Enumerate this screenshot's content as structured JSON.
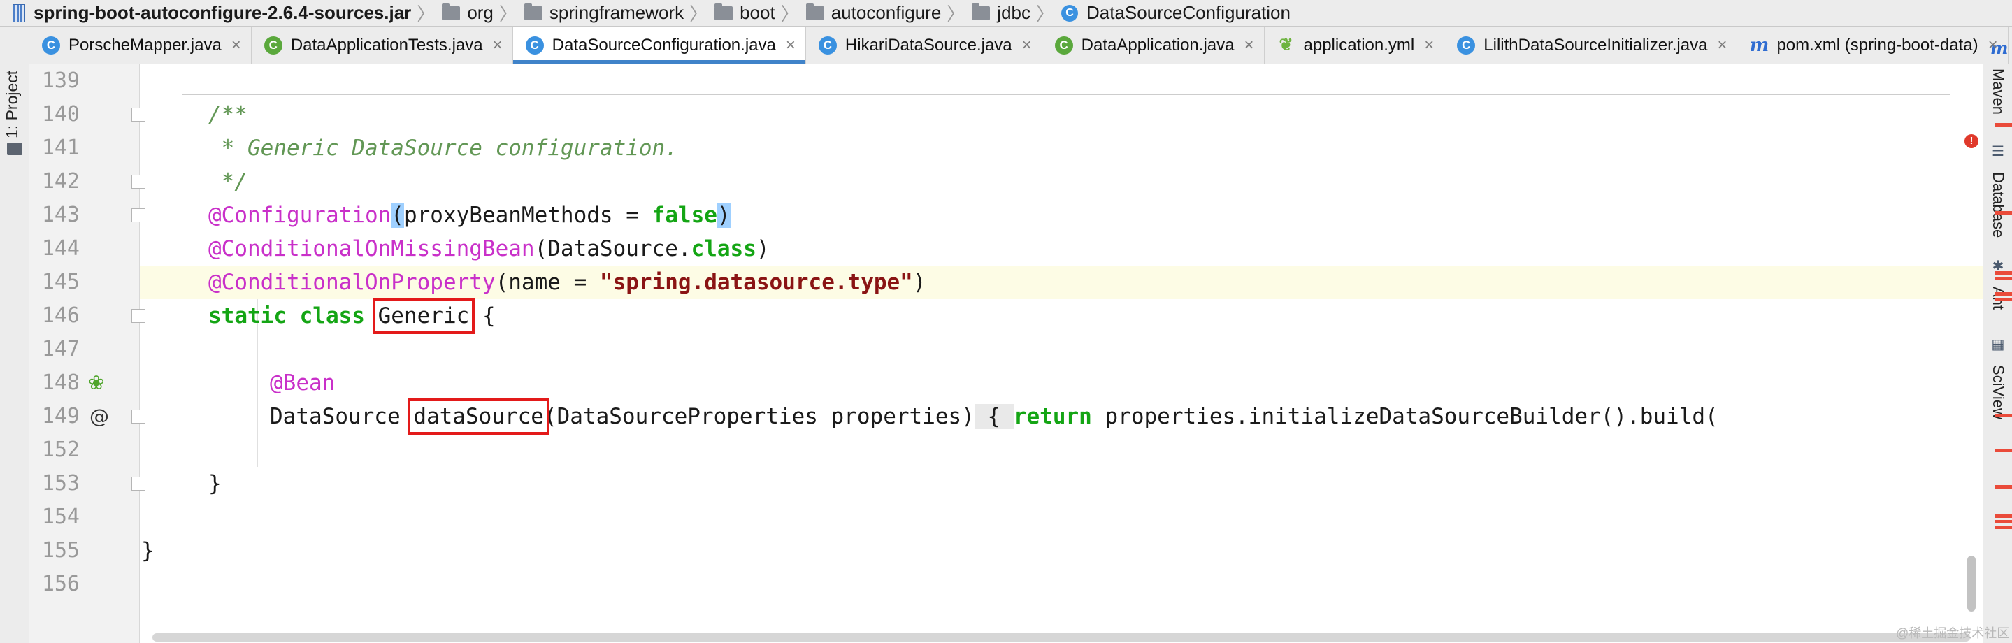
{
  "breadcrumb": [
    {
      "label": "spring-boot-autoconfigure-2.6.4-sources.jar",
      "icon": "jar-icon"
    },
    {
      "label": "org",
      "icon": "folder-icon"
    },
    {
      "label": "springframework",
      "icon": "folder-icon"
    },
    {
      "label": "boot",
      "icon": "folder-icon"
    },
    {
      "label": "autoconfigure",
      "icon": "folder-icon"
    },
    {
      "label": "jdbc",
      "icon": "folder-icon"
    },
    {
      "label": "DataSourceConfiguration",
      "icon": "class-icon"
    }
  ],
  "left_tools": {
    "project": "1: Project"
  },
  "right_tools": {
    "maven": "Maven",
    "database": "Database",
    "ant": "Ant",
    "sciview": "SciView",
    "maven_icon": "m"
  },
  "tabs": [
    {
      "label": "PorscheMapper.java",
      "icon": "C"
    },
    {
      "label": "DataApplicationTests.java",
      "icon": "C"
    },
    {
      "label": "DataSourceConfiguration.java",
      "icon": "C",
      "active": true
    },
    {
      "label": "HikariDataSource.java",
      "icon": "C"
    },
    {
      "label": "DataApplication.java",
      "icon": "C"
    },
    {
      "label": "application.yml",
      "icon": "yml"
    },
    {
      "label": "LilithDataSourceInitializer.java",
      "icon": "C"
    },
    {
      "label": "pom.xml (spring-boot-data)",
      "icon": "m"
    }
  ],
  "editor": {
    "line_numbers": [
      "139",
      "140",
      "141",
      "142",
      "143",
      "144",
      "145",
      "146",
      "147",
      "148",
      "149",
      "152",
      "153",
      "154",
      "155",
      "156"
    ],
    "code": {
      "l140": "/**",
      "l141": " * Generic DataSource configuration.",
      "l142": " */",
      "l143": {
        "anno": "@Configuration",
        "p1": "(",
        "mid": "proxyBeanMethods = ",
        "kw": "false",
        "p2": ")"
      },
      "l144": {
        "anno": "@ConditionalOnMissingBean",
        "mid": "(DataSource.",
        "kw": "class",
        "end": ")"
      },
      "l145": {
        "anno": "@ConditionalOnProperty",
        "mid": "(name = ",
        "str": "\"spring.datasource.type\"",
        "end": ")"
      },
      "l146": {
        "kw": "static class",
        "name": "Generic",
        "end": " {"
      },
      "l148": "@Bean",
      "l149": {
        "type": "DataSource",
        "method": "dataSource",
        "params": "(DataSourceProperties properties)",
        "brace": " { ",
        "kw": "return",
        "rest": " properties.initializeDataSourceBuilder().build("
      },
      "l153": "}",
      "l155": "}"
    },
    "error_badge": "!"
  },
  "watermark": "@稀土掘金技术社区"
}
